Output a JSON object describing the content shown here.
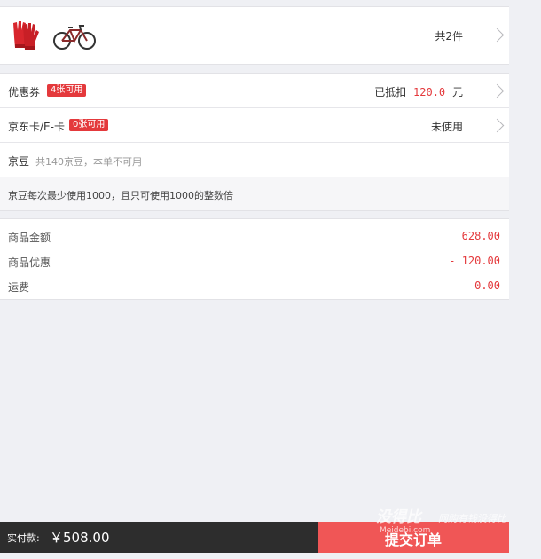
{
  "products": {
    "images": [
      {
        "icon": "red-gloves-icon",
        "color": "#d8262d"
      },
      {
        "icon": "bicycle-icon",
        "color": "#333333"
      }
    ],
    "count_label": "共2件"
  },
  "coupons": {
    "label": "优惠券",
    "badge": "4张可用",
    "deducted_prefix": "已抵扣",
    "deducted_amount": "120.0",
    "deducted_unit": "元"
  },
  "cards": {
    "label": "京东卡/E-卡",
    "badge": "0张可用",
    "status": "未使用"
  },
  "beans": {
    "label": "京豆",
    "info": "共140京豆，本单不可用",
    "note": "京豆每次最少使用1000，且只可使用1000的整数倍"
  },
  "totals": [
    {
      "label": "商品金额",
      "value": "628.00"
    },
    {
      "label": "商品优惠",
      "value": "- 120.00"
    },
    {
      "label": "运费",
      "value": "0.00"
    }
  ],
  "footer": {
    "paid_label": "实付款:",
    "paid_amount": "￥508.00",
    "submit_label": "提交订单"
  },
  "watermark": {
    "brand": "没得比",
    "domain": "Meidebi.com",
    "slogan": "网购有钱没得比"
  },
  "colors": {
    "accent": "#e4393c",
    "submit": "#f05656",
    "footer_bg": "#2d2d2d",
    "page_bg": "#eff0f4"
  }
}
